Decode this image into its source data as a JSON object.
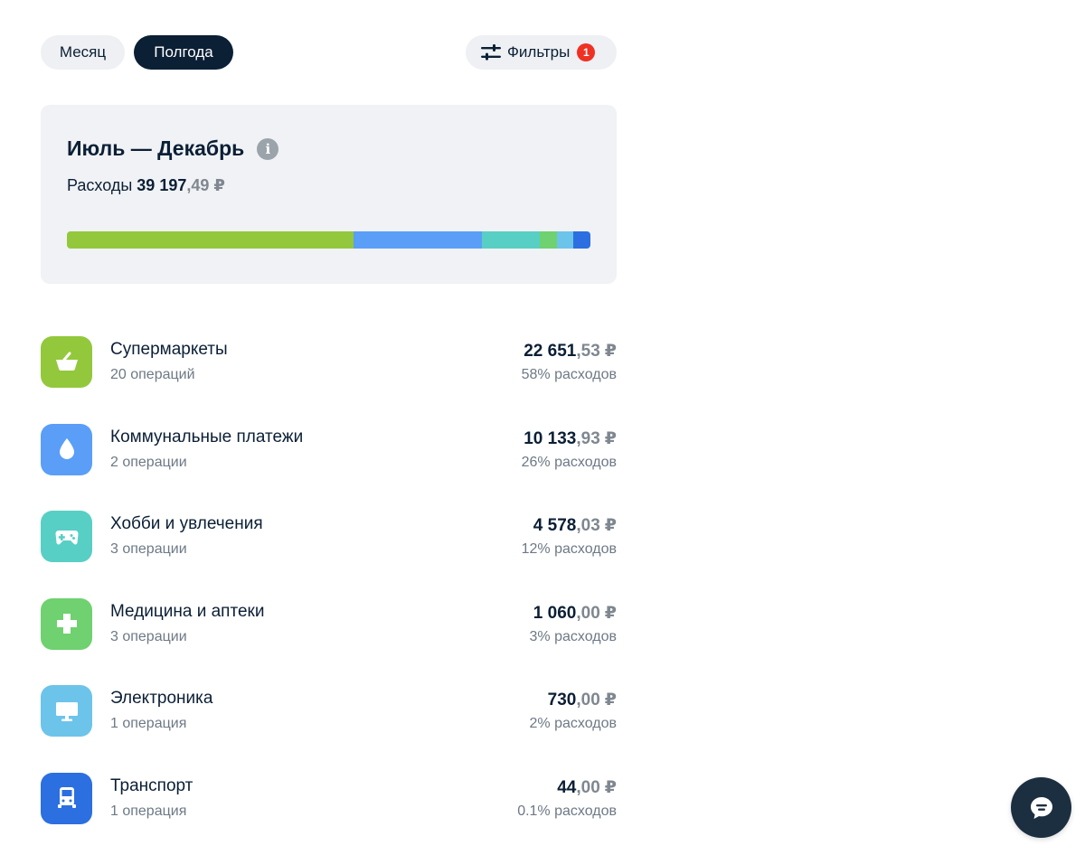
{
  "period_tabs": {
    "month": "Месяц",
    "half_year": "Полгода",
    "active": "half_year"
  },
  "filters": {
    "label": "Фильтры",
    "count": "1"
  },
  "summary": {
    "title": "Июль — Декабрь",
    "expenses_label": "Расходы",
    "total_int": "39 197",
    "total_frac": ",49",
    "currency": "₽",
    "distribution": [
      {
        "category": "Супермаркеты",
        "share": 57.8,
        "color": "#93c83c"
      },
      {
        "category": "Коммунальные платежи",
        "share": 25.9,
        "color": "#5a9ef8"
      },
      {
        "category": "Хобби и увлечения",
        "share": 11.7,
        "color": "#58cfc4"
      },
      {
        "category": "Медицина и аптеки",
        "share": 3.4,
        "color": "#6fd16f"
      },
      {
        "category": "Электроника",
        "share": 3.4,
        "color": "#6cc4ea"
      },
      {
        "category": "Транспорт",
        "share": 3.4,
        "color": "#2c6fe0"
      }
    ]
  },
  "categories": [
    {
      "name": "Супермаркеты",
      "ops": "20 операций",
      "amount_int": "22 651",
      "amount_frac": ",53",
      "currency": "₽",
      "share": "58% расходов",
      "icon": "basket-icon",
      "color": "#93c83c"
    },
    {
      "name": "Коммунальные платежи",
      "ops": "2 операции",
      "amount_int": "10 133",
      "amount_frac": ",93",
      "currency": "₽",
      "share": "26% расходов",
      "icon": "water-drop-icon",
      "color": "#5a9ef8"
    },
    {
      "name": "Хобби и увлечения",
      "ops": "3 операции",
      "amount_int": "4 578",
      "amount_frac": ",03",
      "currency": "₽",
      "share": "12% расходов",
      "icon": "gamepad-icon",
      "color": "#58cfc4"
    },
    {
      "name": "Медицина и аптеки",
      "ops": "3 операции",
      "amount_int": "1 060",
      "amount_frac": ",00",
      "currency": "₽",
      "share": "3% расходов",
      "icon": "medical-cross-icon",
      "color": "#6fd16f"
    },
    {
      "name": "Электроника",
      "ops": "1 операция",
      "amount_int": "730",
      "amount_frac": ",00",
      "currency": "₽",
      "share": "2% расходов",
      "icon": "monitor-icon",
      "color": "#6cc4ea"
    },
    {
      "name": "Транспорт",
      "ops": "1 операция",
      "amount_int": "44",
      "amount_frac": ",00",
      "currency": "₽",
      "share": "0.1% расходов",
      "icon": "bus-icon",
      "color": "#2c6fe0"
    }
  ],
  "chat": {
    "icon": "chat-icon"
  }
}
